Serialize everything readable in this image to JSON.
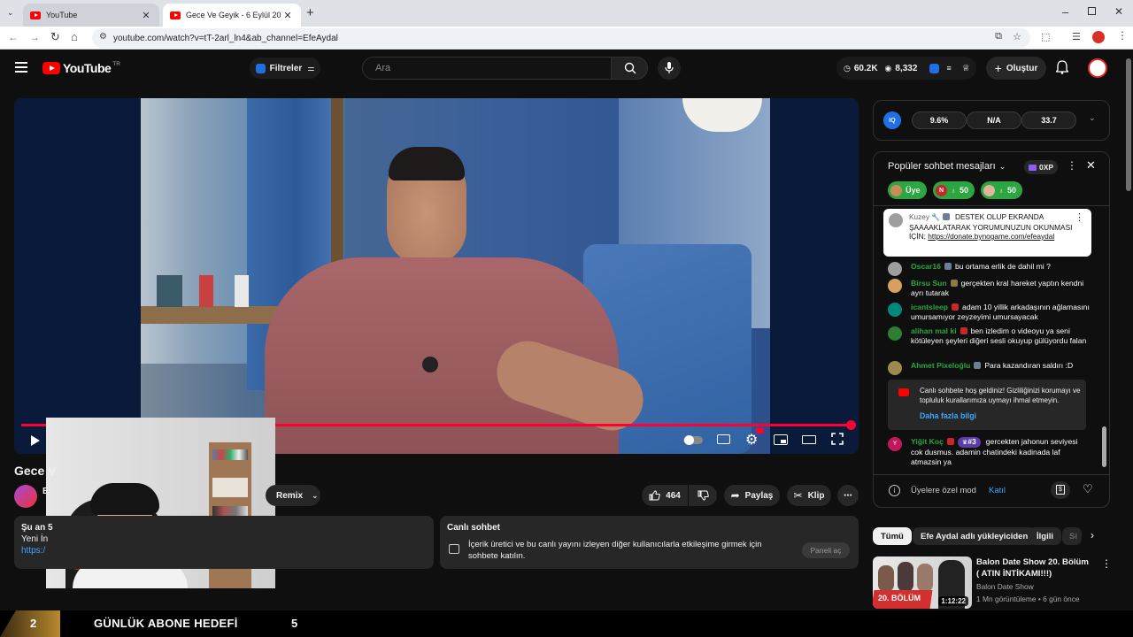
{
  "browser": {
    "tabs": [
      {
        "title": "YouTube"
      },
      {
        "title": "Gece Ve Geyik - 6 Eylül 2025 - Y"
      }
    ],
    "url": "youtube.com/watch?v=tT-2arl_ln4&ab_channel=EfeAydal"
  },
  "header": {
    "logo_text": "YouTube",
    "region": "TR",
    "filters_label": "Filtreler",
    "search_placeholder": "Ara",
    "stat_views": "60.2K",
    "stat_viewers": "8,332",
    "create_label": "Oluştur"
  },
  "video": {
    "title_partial": "Gece V",
    "channel_initial": "E"
  },
  "actions": {
    "remix": "Remix",
    "likes": "464",
    "share": "Paylaş",
    "clip": "Klip"
  },
  "description": {
    "line1": "Şu an 5",
    "line2": "Yeni İn",
    "line3": "https:/"
  },
  "livechat_card": {
    "title": "Canlı sohbet",
    "text": "İçerik üretici ve bu canlı yayını izleyen diğer kullanıcılarla etkileşime girmek için sohbete katılın.",
    "button": "Paneli aç"
  },
  "stats_panel": {
    "v1": "9.6%",
    "v2": "N/A",
    "v3": "33.7"
  },
  "chat": {
    "title": "Popüler sohbet mesajları",
    "xp": "0XP",
    "pills": [
      {
        "label": "Üye"
      },
      {
        "label": "N",
        "count": "50"
      },
      {
        "label": "",
        "count": "50"
      }
    ],
    "pinned": {
      "author": "Kuzey",
      "text": "DESTEK OLUP EKRANDA ŞAAAAKLATARAK YORUMUNUZUN OKUNMASI İÇİN;",
      "link": "https://donate.bynogame.com/efeaydal"
    },
    "messages": [
      {
        "author": "Oscar16",
        "text": "bu ortama erlik de dahil mi ?",
        "color": "#2ba640"
      },
      {
        "author": "Birsu Sun",
        "text": "gerçekten kral hareket yaptın kendni ayrı tutarak",
        "color": "#2ba640"
      },
      {
        "author": "icantsleep",
        "text": "adam 10 yillik arkadaşının ağlamasını umursamıyor zeyzeyimi umursayacak",
        "color": "#2ba640"
      },
      {
        "author": "alihan mal ki",
        "text": "ben izledim o videoyu ya seni kötüleyen şeyleri diğeri sesli okuyup gülüyordu falan",
        "color": "#2ba640"
      },
      {
        "author": "Ahmet Pixeloğlu",
        "text": "Para kazandıran saldırı :D",
        "color": "#2ba640"
      }
    ],
    "welcome": {
      "text": "Canlı sohbete hoş geldiniz! Gizliliğinizi korumayı ve topluluk kurallarımıza uymayı ihmal etmeyin.",
      "link": "Daha fazla bilgi"
    },
    "last": {
      "author": "Yiğit Koç",
      "badge": "#3",
      "text": "gercekten jahonun seviyesi cok dusmus. adamin chatindeki kadinada laf atmazsin ya"
    },
    "members_mode": "Üyelere özel mod",
    "join": "Katıl"
  },
  "chips": [
    "Tümü",
    "Efe Aydal adlı yükleyiciden",
    "İlgili",
    "Si"
  ],
  "recommended": {
    "title": "Balon Date Show 20. Bölüm ( ATIN İNTİKAMI!!!)",
    "channel": "Balon Date Show",
    "meta": "1 Mn görüntüleme • 6 gün önce",
    "duration": "1:12:22",
    "thumb_text": "20. BÖLÜM"
  },
  "goal": {
    "current": "2",
    "label": "GÜNLÜK ABONE HEDEFİ",
    "target": "5"
  },
  "colors": {
    "accent_red": "#ff0033",
    "link_blue": "#3ea6ff",
    "chat_name_green": "#2ba640"
  }
}
